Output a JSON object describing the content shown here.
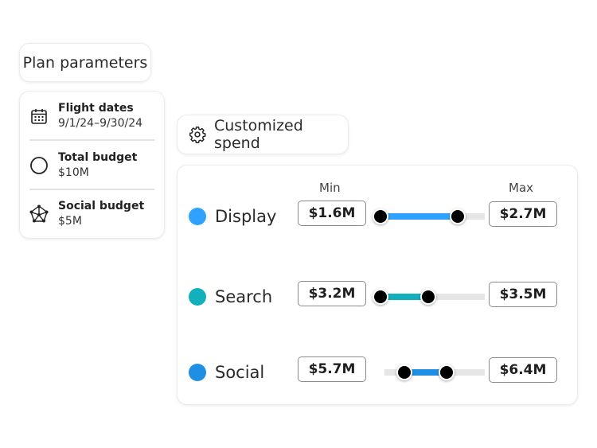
{
  "plan": {
    "title": "Plan parameters",
    "params": [
      {
        "icon": "calendar-icon",
        "label": "Flight dates",
        "value": "9/1/24–9/30/24"
      },
      {
        "icon": "circle-icon",
        "label": "Total budget",
        "value": "$10M"
      },
      {
        "icon": "network-icon",
        "label": "Social budget",
        "value": "$5M"
      }
    ]
  },
  "spend": {
    "title": "Customized spend",
    "icon": "gear-icon",
    "min_label": "Min",
    "max_label": "Max",
    "channels": [
      {
        "name": "Display",
        "color": "#2fa2ff",
        "min": "$1.6M",
        "max": "$2.7M",
        "range_start": 0.0,
        "range_end": 0.73,
        "track_start": 0.0
      },
      {
        "name": "Search",
        "color": "#12b0bd",
        "min": "$3.2M",
        "max": "$3.5M",
        "range_start": 0.0,
        "range_end": 0.45,
        "track_start": 0.0
      },
      {
        "name": "Social",
        "color": "#1f8fe6",
        "min": "$5.7M",
        "max": "$6.4M",
        "range_start": 0.18,
        "range_end": 0.6,
        "track_start": 0.0
      }
    ]
  }
}
